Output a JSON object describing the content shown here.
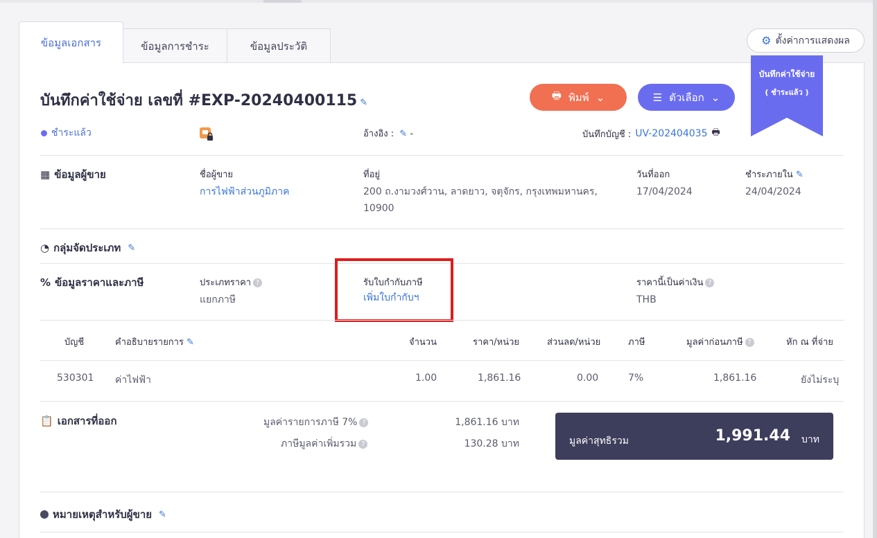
{
  "tabs": [
    {
      "label": "ข้อมูลเอกสาร"
    },
    {
      "label": "ข้อมูลการชำระ"
    },
    {
      "label": "ข้อมูลประวัติ"
    }
  ],
  "settings": {
    "label": "ตั้งค่าการแสดงผล"
  },
  "ribbon": {
    "line1": "บันทึกค่าใช้จ่าย",
    "line2": "( ชำระแล้ว )",
    "color": "#6a6cf0"
  },
  "header": {
    "title": "บันทึกค่าใช้จ่าย เลขที่ #EXP-20240400115",
    "print_label": "พิมพ์",
    "options_label": "ตัวเลือก",
    "status": "ชำระแล้ว",
    "reference_label": "อ้างอิง :",
    "reference_value": "-",
    "ledger_label": "บันทึกบัญชี :",
    "ledger_value": "UV-202404035"
  },
  "vendor": {
    "section": "ข้อมูลผู้ขาย",
    "name_label": "ชื่อผู้ขาย",
    "name_value": "การไฟฟ้าส่วนภูมิภาค",
    "address_label": "ที่อยู่",
    "address_line1": "200 ถ.งามวงศ์วาน, ลาดยาว, จตุจักร, กรุงเทพมหานคร,",
    "address_line2": "10900",
    "issue_label": "วันที่ออก",
    "issue_value": "17/04/2024",
    "due_label": "ชำระภายใน",
    "due_value": "24/04/2024"
  },
  "category": {
    "section": "กลุ่มจัดประเภท"
  },
  "pricing": {
    "section": "ข้อมูลราคาและภาษี",
    "price_type_label": "ประเภทราคา",
    "price_type_value": "แยกภาษี",
    "tax_invoice_label": "รับใบกำกับภาษี",
    "tax_invoice_link": "เพิ่มใบกำกับฯ",
    "currency_label": "ราคานี้เป็นค่าเงิน",
    "currency_value": "THB"
  },
  "table": {
    "headers": {
      "account": "บัญชี",
      "description": "คำอธิบายรายการ",
      "qty": "จำนวน",
      "unit_price": "ราคา/หน่วย",
      "discount": "ส่วนลด/หน่วย",
      "tax": "ภาษี",
      "pre_tax": "มูลค่าก่อนภาษี",
      "withholding": "หัก ณ ที่จ่าย"
    },
    "rows": [
      {
        "account": "530301",
        "description": "ค่าไฟฟ้า",
        "qty": "1.00",
        "unit_price": "1,861.16",
        "discount": "0.00",
        "tax": "7%",
        "pre_tax": "1,861.16",
        "withholding": "ยังไม่ระบุ"
      }
    ]
  },
  "summary": {
    "section": "เอกสารที่ออก",
    "taxable_label": "มูลค่ารายการภาษี 7%",
    "taxable_value": "1,861.16 บาท",
    "vat_label": "ภาษีมูลค่าเพิ่มรวม",
    "vat_value": "130.28 บาท",
    "total_label": "มูลค่าสุทธิรวม",
    "total_value": "1,991.44",
    "total_unit": "บาท"
  },
  "notes": {
    "section": "หมายเหตุสำหรับผู้ขาย"
  }
}
